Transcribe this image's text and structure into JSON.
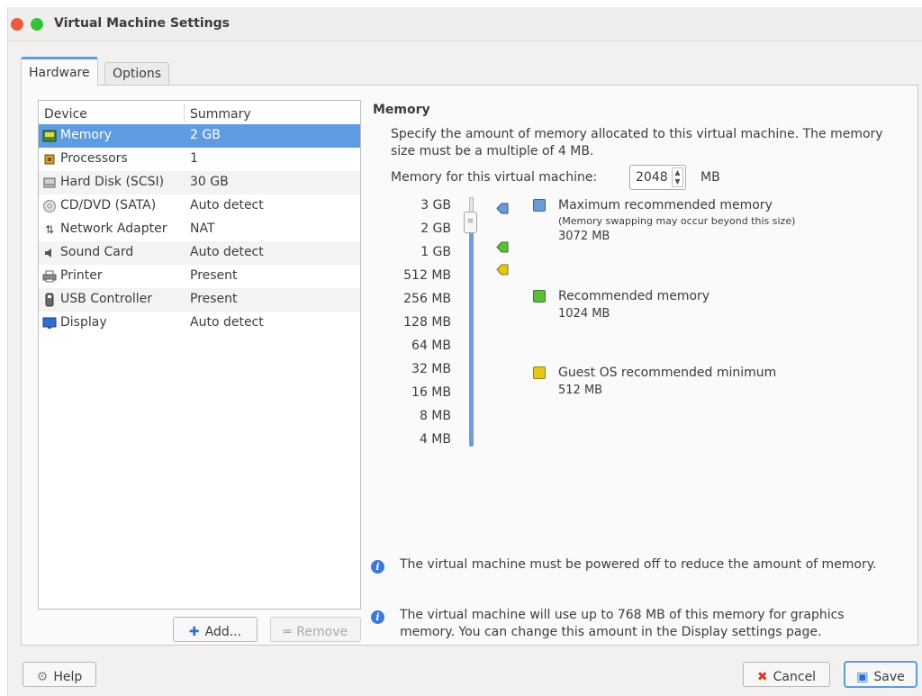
{
  "window": {
    "title": "Virtual Machine Settings"
  },
  "tabs": [
    {
      "label": "Hardware",
      "active": true
    },
    {
      "label": "Options",
      "active": false
    }
  ],
  "device_list": {
    "columns": [
      "Device",
      "Summary"
    ],
    "rows": [
      {
        "icon": "memory-icon",
        "device": "Memory",
        "summary": "2 GB",
        "selected": true
      },
      {
        "icon": "processor-icon",
        "device": "Processors",
        "summary": "1"
      },
      {
        "icon": "hard-disk-icon",
        "device": "Hard Disk (SCSI)",
        "summary": "30 GB"
      },
      {
        "icon": "cd-dvd-icon",
        "device": "CD/DVD (SATA)",
        "summary": "Auto detect"
      },
      {
        "icon": "network-adapter-icon",
        "device": "Network Adapter",
        "summary": "NAT"
      },
      {
        "icon": "sound-card-icon",
        "device": "Sound Card",
        "summary": "Auto detect"
      },
      {
        "icon": "printer-icon",
        "device": "Printer",
        "summary": "Present"
      },
      {
        "icon": "usb-controller-icon",
        "device": "USB Controller",
        "summary": "Present"
      },
      {
        "icon": "display-icon",
        "device": "Display",
        "summary": "Auto detect"
      }
    ],
    "add_label": "Add...",
    "remove_label": "Remove"
  },
  "memory": {
    "title": "Memory",
    "description": "Specify the amount of memory allocated to this virtual machine. The memory size must be a multiple of 4 MB.",
    "field_label": "Memory for this virtual machine:",
    "field_value": "2048",
    "unit": "MB",
    "scale_labels": [
      "3 GB",
      "2 GB",
      "1 GB",
      "512 MB",
      "256 MB",
      "128 MB",
      "64 MB",
      "32 MB",
      "16 MB",
      "8 MB",
      "4 MB"
    ],
    "selected_value_mb": 2048,
    "legend": [
      {
        "title": "Maximum recommended memory",
        "note": "(Memory swapping may occur beyond this size)",
        "value": "3072 MB",
        "color": "#6a9ad8"
      },
      {
        "title": "Recommended memory",
        "value": "1024 MB",
        "color": "#5cbf3a"
      },
      {
        "title": "Guest OS recommended minimum",
        "value": "512 MB",
        "color": "#e6c619"
      }
    ],
    "info": [
      "The virtual machine must be powered off to reduce the amount of memory.",
      "The virtual machine will use up to 768 MB of this memory for graphics memory. You can change this amount in the Display settings page."
    ]
  },
  "footer": {
    "help_label": "Help",
    "cancel_label": "Cancel",
    "save_label": "Save"
  }
}
